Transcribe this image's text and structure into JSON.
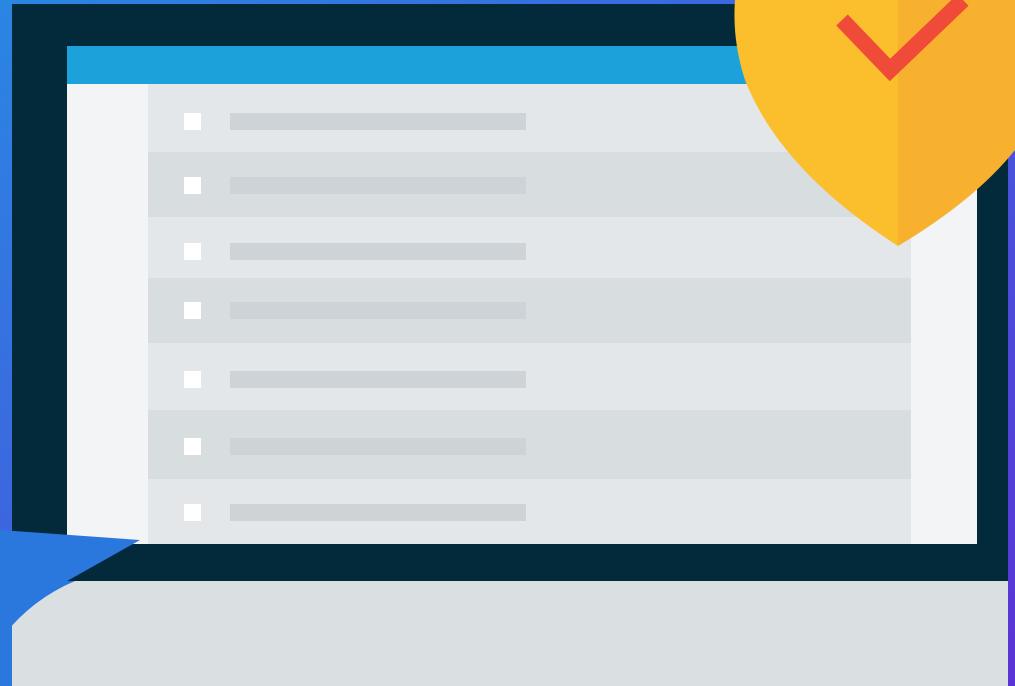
{
  "colors": {
    "background_start": "#2a7be0",
    "background_end": "#5a3ad8",
    "monitor_frame": "#032a3a",
    "titlebar": "#1da1db",
    "screen": "#f2f4f6",
    "row_light": "#e3e7ea",
    "row_dark": "#d8dde0",
    "checkbox": "#ffffff",
    "text_placeholder": "#cdd3d6",
    "base": "#dadfe2",
    "shield_left": "#fbbf2e",
    "shield_right": "#f7b12f",
    "checkmark": "#f04a38"
  },
  "icons": {
    "shield": "shield-check-icon",
    "checkbox": "checkbox-icon"
  },
  "list": {
    "rows": [
      {
        "checked": false,
        "text": ""
      },
      {
        "checked": false,
        "text": ""
      },
      {
        "checked": false,
        "text": ""
      },
      {
        "checked": false,
        "text": ""
      },
      {
        "checked": false,
        "text": ""
      },
      {
        "checked": false,
        "text": ""
      },
      {
        "checked": false,
        "text": ""
      }
    ]
  }
}
